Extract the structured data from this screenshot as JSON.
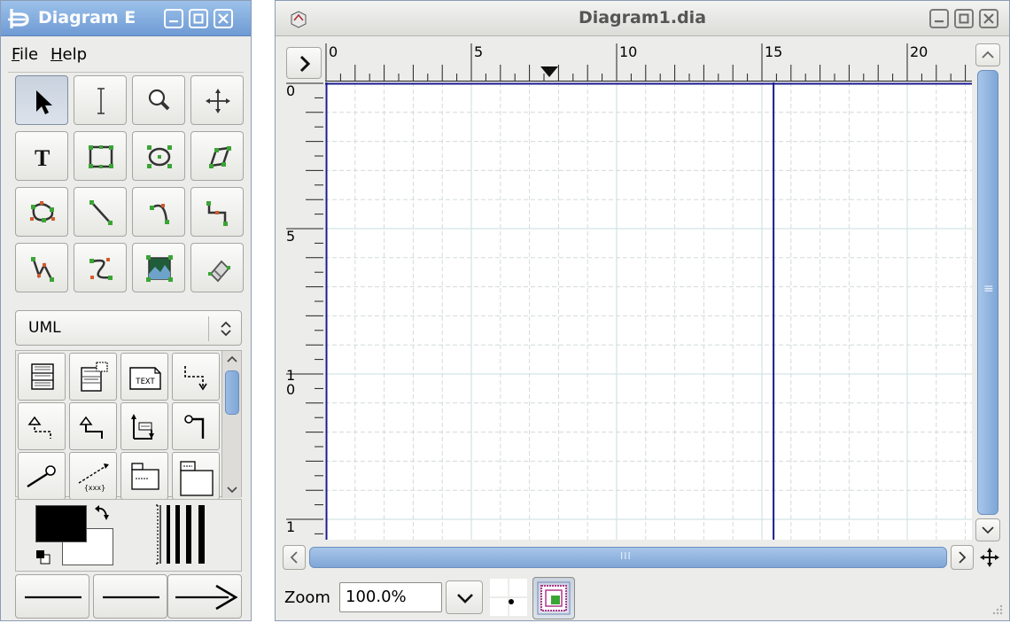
{
  "toolbox": {
    "title": "Diagram E",
    "menu": [
      {
        "label": "File",
        "mnemonic": "F",
        "rest": "ile"
      },
      {
        "label": "Help",
        "mnemonic": "H",
        "rest": "elp"
      }
    ],
    "tools": [
      {
        "name": "pointer-tool-button",
        "icon": "pointer-icon"
      },
      {
        "name": "text-edit-tool-button",
        "icon": "ibeam-icon"
      },
      {
        "name": "magnify-tool-button",
        "icon": "magnify-icon"
      },
      {
        "name": "scroll-tool-button",
        "icon": "move-icon"
      },
      {
        "name": "text-tool-button",
        "icon": "text-icon"
      },
      {
        "name": "box-tool-button",
        "icon": "box-icon"
      },
      {
        "name": "ellipse-tool-button",
        "icon": "ellipse-icon"
      },
      {
        "name": "polygon-tool-button",
        "icon": "polygon-icon"
      },
      {
        "name": "beziergon-tool-button",
        "icon": "beziergon-icon"
      },
      {
        "name": "line-tool-button",
        "icon": "line-icon"
      },
      {
        "name": "arc-tool-button",
        "icon": "arc-icon"
      },
      {
        "name": "zigzagline-tool-button",
        "icon": "zigzag-icon"
      },
      {
        "name": "polyline-tool-button",
        "icon": "polyline-icon"
      },
      {
        "name": "bezierline-tool-button",
        "icon": "bezier-icon"
      },
      {
        "name": "image-tool-button",
        "icon": "image-icon"
      },
      {
        "name": "outline-tool-button",
        "icon": "outline-icon"
      }
    ],
    "sheet_selected": "UML",
    "sheet_shapes": [
      {
        "name": "uml-class-shape",
        "icon": "class-icon"
      },
      {
        "name": "uml-template-class-shape",
        "icon": "template-class-icon"
      },
      {
        "name": "uml-note-shape",
        "icon": "note-icon",
        "text": "TEXT"
      },
      {
        "name": "uml-dependency-shape",
        "icon": "dependency-icon"
      },
      {
        "name": "uml-realizes-shape",
        "icon": "realizes-icon"
      },
      {
        "name": "uml-generalization-shape",
        "icon": "generalization-icon"
      },
      {
        "name": "uml-association-shape",
        "icon": "association-icon"
      },
      {
        "name": "uml-implements-shape",
        "icon": "implements-icon"
      },
      {
        "name": "uml-constraint-shape",
        "icon": "lollipop-icon"
      },
      {
        "name": "uml-small-package-shape",
        "icon": "constraint-icon",
        "text": "{xxx}"
      },
      {
        "name": "uml-large-package-shape",
        "icon": "small-package-icon"
      },
      {
        "name": "uml-package-shape",
        "icon": "large-package-icon"
      }
    ],
    "foreground_color": "#000000",
    "background_color": "#ffffff"
  },
  "canvas_window": {
    "title": "Diagram1.dia",
    "ruler_h_labels": [
      "0",
      "5",
      "10",
      "15",
      "20"
    ],
    "ruler_v_labels": [
      "0",
      "5",
      "1\n0",
      "1"
    ],
    "zoom_label": "Zoom",
    "zoom_value": "100.0%",
    "hscroll_grip": "III",
    "vscroll_grip": "≡"
  },
  "colors": {
    "accent": "#6f9bd4",
    "scroll_fill": "#86acd9",
    "page_border": "#1a1a8c",
    "grid_major": "#c9dfdf",
    "grid_minor": "#d4dada"
  }
}
